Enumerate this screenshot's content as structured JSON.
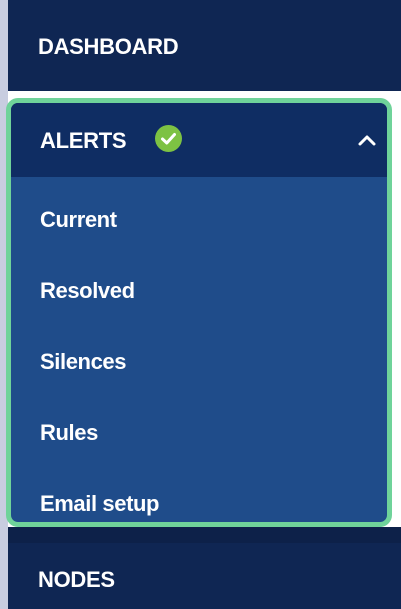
{
  "nav": {
    "dashboard_label": "DASHBOARD",
    "alerts": {
      "label": "ALERTS",
      "status_icon": "check-circle-icon",
      "expand_icon": "chevron-up-icon",
      "expanded": true,
      "items": [
        {
          "label": "Current"
        },
        {
          "label": "Resolved"
        },
        {
          "label": "Silences"
        },
        {
          "label": "Rules"
        },
        {
          "label": "Email setup"
        }
      ]
    },
    "nodes_label": "NODES"
  },
  "colors": {
    "nav_background": "#0f2653",
    "alerts_header": "#0f2d63",
    "submenu_background": "#1f4c8a",
    "highlight_border": "#6fd39a",
    "status_ok": "#7dc243",
    "text": "#ffffff"
  }
}
